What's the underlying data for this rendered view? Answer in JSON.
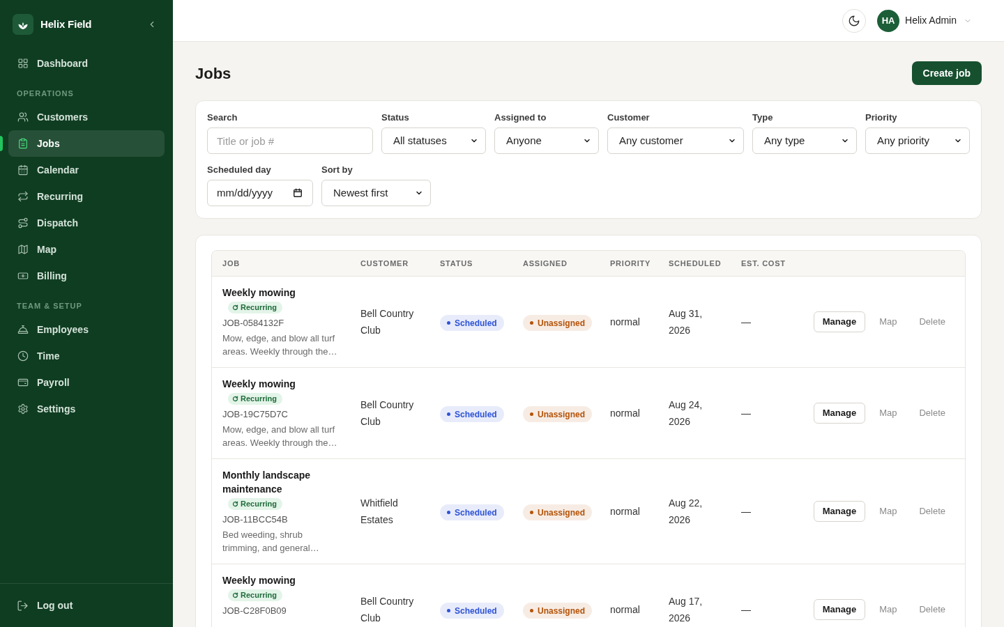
{
  "sidebar": {
    "brand": "Helix Field",
    "nav": [
      {
        "label": "Dashboard",
        "selected": false
      }
    ],
    "sections": [
      {
        "heading": "OPERATIONS",
        "items": [
          {
            "label": "Customers",
            "selected": false
          },
          {
            "label": "Jobs",
            "selected": true
          },
          {
            "label": "Calendar",
            "selected": false
          },
          {
            "label": "Recurring",
            "selected": false
          },
          {
            "label": "Dispatch",
            "selected": false
          },
          {
            "label": "Map",
            "selected": false
          },
          {
            "label": "Billing",
            "selected": false
          }
        ]
      },
      {
        "heading": "TEAM & SETUP",
        "items": [
          {
            "label": "Employees",
            "selected": false
          },
          {
            "label": "Time",
            "selected": false
          },
          {
            "label": "Payroll",
            "selected": false
          },
          {
            "label": "Settings",
            "selected": false
          }
        ]
      }
    ],
    "footer": {
      "label": "Log out"
    }
  },
  "header": {
    "user": {
      "initials": "HA",
      "name": "Helix Admin"
    }
  },
  "page": {
    "title": "Jobs",
    "primary_action": "Create job"
  },
  "filters": [
    {
      "label": "Search",
      "kind": "text",
      "placeholder": "Title or job #"
    },
    {
      "label": "Status",
      "kind": "select",
      "value": "All statuses"
    },
    {
      "label": "Assigned to",
      "kind": "select",
      "value": "Anyone"
    },
    {
      "label": "Customer",
      "kind": "select",
      "value": "Any customer"
    },
    {
      "label": "Type",
      "kind": "select",
      "value": "Any type"
    },
    {
      "label": "Priority",
      "kind": "select",
      "value": "Any priority"
    },
    {
      "label": "Scheduled day",
      "kind": "date",
      "placeholder": "mm/dd/yyyy"
    },
    {
      "label": "Sort by",
      "kind": "select",
      "value": "Newest first"
    }
  ],
  "table": {
    "columns": [
      "JOB",
      "CUSTOMER",
      "STATUS",
      "ASSIGNED",
      "PRIORITY",
      "SCHEDULED",
      "EST. COST"
    ],
    "rows": [
      {
        "title": "Weekly mowing",
        "badge": "Recurring",
        "job_number": "JOB-0584132F",
        "description": "Mow, edge, and blow all turf areas. Weekly through the…",
        "customer": "Bell Country Club",
        "status": {
          "label": "Scheduled",
          "color": "#2f54d6"
        },
        "assigned": {
          "label": "Unassigned",
          "color": "#b45309"
        },
        "priority": "normal",
        "scheduled": "Aug 31, 2026",
        "est_cost": "—",
        "actions": [
          {
            "label": "Manage",
            "kind": "outline"
          },
          {
            "label": "Map",
            "kind": "link"
          },
          {
            "label": "Delete",
            "kind": "link"
          }
        ]
      },
      {
        "title": "Weekly mowing",
        "badge": "Recurring",
        "job_number": "JOB-19C75D7C",
        "description": "Mow, edge, and blow all turf areas. Weekly through the…",
        "customer": "Bell Country Club",
        "status": {
          "label": "Scheduled",
          "color": "#2f54d6"
        },
        "assigned": {
          "label": "Unassigned",
          "color": "#b45309"
        },
        "priority": "normal",
        "scheduled": "Aug 24, 2026",
        "est_cost": "—",
        "actions": [
          {
            "label": "Manage",
            "kind": "outline"
          },
          {
            "label": "Map",
            "kind": "link"
          },
          {
            "label": "Delete",
            "kind": "link"
          }
        ]
      },
      {
        "title": "Monthly landscape maintenance",
        "badge": "Recurring",
        "job_number": "JOB-11BCC54B",
        "description": "Bed weeding, shrub trimming, and general…",
        "customer": "Whitfield Estates",
        "status": {
          "label": "Scheduled",
          "color": "#2f54d6"
        },
        "assigned": {
          "label": "Unassigned",
          "color": "#b45309"
        },
        "priority": "normal",
        "scheduled": "Aug 22, 2026",
        "est_cost": "—",
        "actions": [
          {
            "label": "Manage",
            "kind": "outline"
          },
          {
            "label": "Map",
            "kind": "link"
          },
          {
            "label": "Delete",
            "kind": "link"
          }
        ]
      },
      {
        "title": "Weekly mowing",
        "badge": "Recurring",
        "job_number": "JOB-C28F0B09",
        "customer": "Bell Country Club",
        "status": {
          "label": "Scheduled",
          "color": "#2f54d6"
        },
        "assigned": {
          "label": "Unassigned",
          "color": "#b45309"
        },
        "priority": "normal",
        "scheduled": "Aug 17, 2026",
        "est_cost": "—",
        "actions": [
          {
            "label": "Manage",
            "kind": "outline"
          },
          {
            "label": "Map",
            "kind": "link"
          },
          {
            "label": "Delete",
            "kind": "link"
          }
        ]
      }
    ]
  }
}
